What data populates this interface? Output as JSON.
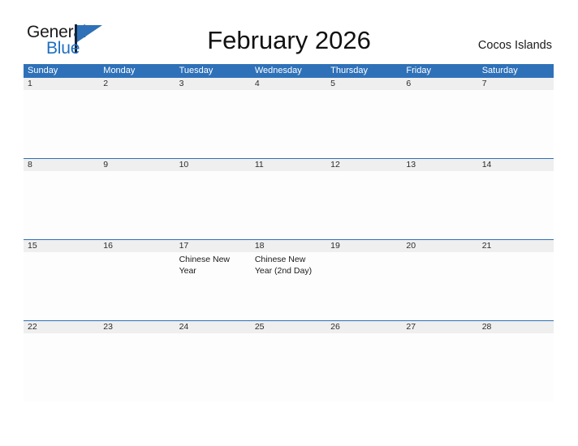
{
  "logo": {
    "word_one": "General",
    "word_two": "Blue",
    "flag_icon": "triangle-flag-icon",
    "bar_color": "#12243a",
    "blue_color": "#1e6fc0"
  },
  "header": {
    "title": "February 2026",
    "region": "Cocos Islands"
  },
  "theme": {
    "header_blue": "#2e71b8",
    "date_band_gray": "#efefef",
    "rule_blue": "#2e71b8",
    "cell_background": "#fdfdfd",
    "text_dark": "#1a1a1a"
  },
  "calendar": {
    "weekdays": [
      "Sunday",
      "Monday",
      "Tuesday",
      "Wednesday",
      "Thursday",
      "Friday",
      "Saturday"
    ],
    "weeks": [
      [
        {
          "date": "1",
          "events": []
        },
        {
          "date": "2",
          "events": []
        },
        {
          "date": "3",
          "events": []
        },
        {
          "date": "4",
          "events": []
        },
        {
          "date": "5",
          "events": []
        },
        {
          "date": "6",
          "events": []
        },
        {
          "date": "7",
          "events": []
        }
      ],
      [
        {
          "date": "8",
          "events": []
        },
        {
          "date": "9",
          "events": []
        },
        {
          "date": "10",
          "events": []
        },
        {
          "date": "11",
          "events": []
        },
        {
          "date": "12",
          "events": []
        },
        {
          "date": "13",
          "events": []
        },
        {
          "date": "14",
          "events": []
        }
      ],
      [
        {
          "date": "15",
          "events": []
        },
        {
          "date": "16",
          "events": []
        },
        {
          "date": "17",
          "events": [
            "Chinese New Year"
          ]
        },
        {
          "date": "18",
          "events": [
            "Chinese New Year (2nd Day)"
          ]
        },
        {
          "date": "19",
          "events": []
        },
        {
          "date": "20",
          "events": []
        },
        {
          "date": "21",
          "events": []
        }
      ],
      [
        {
          "date": "22",
          "events": []
        },
        {
          "date": "23",
          "events": []
        },
        {
          "date": "24",
          "events": []
        },
        {
          "date": "25",
          "events": []
        },
        {
          "date": "26",
          "events": []
        },
        {
          "date": "27",
          "events": []
        },
        {
          "date": "28",
          "events": []
        }
      ]
    ]
  }
}
